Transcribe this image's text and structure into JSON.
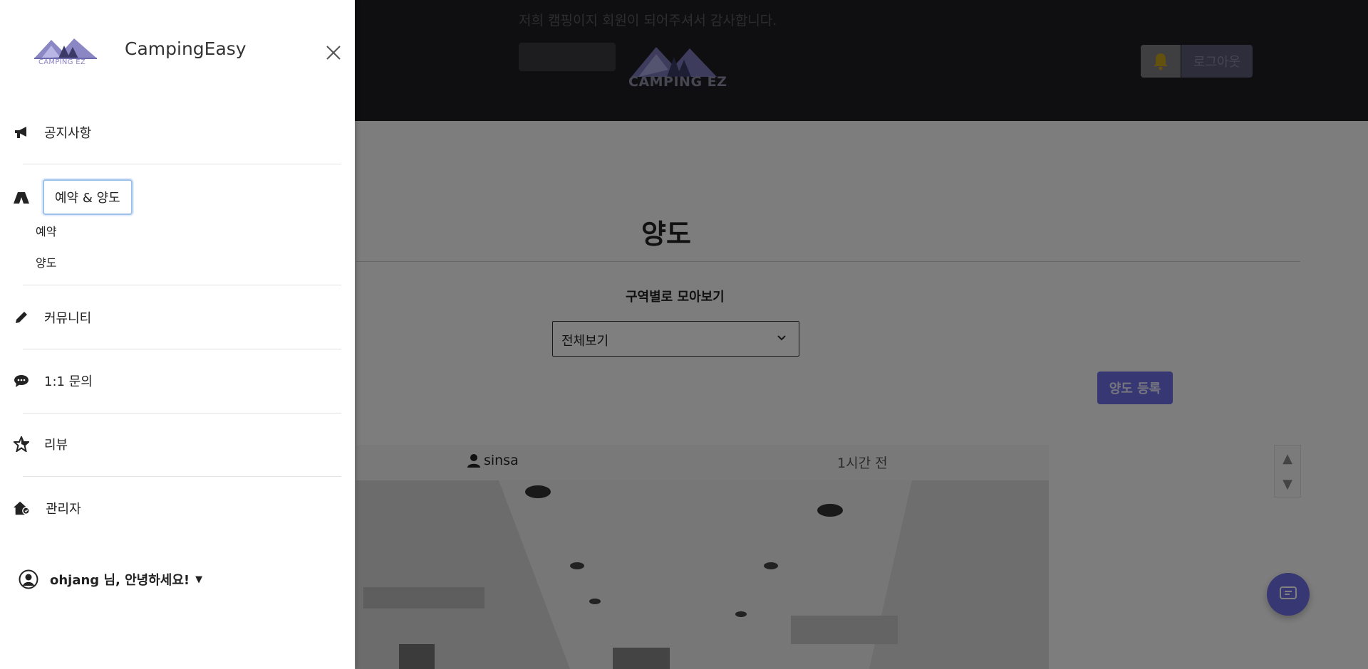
{
  "header": {
    "announcement": "저희 캠핑이지 회원이 되어주셔서 감사합니다.",
    "logo_text": "CAMPING EZ",
    "bell_icon": "bell-icon",
    "logout_label": "로그아웃",
    "bell_color": "#f5c518"
  },
  "main": {
    "title": "양도",
    "filter_label": "구역별로 모아보기",
    "filter_value": "전체보기",
    "register_label": "양도 등록",
    "post": {
      "username": "sinsa",
      "time": "1시간 전"
    },
    "accent_color": "#6e6ee6"
  },
  "drawer": {
    "logo_text": "CAMPING EZ",
    "brand": "CampingEasy",
    "menu": [
      {
        "label": "공지사항",
        "icon": "megaphone-icon"
      },
      {
        "label": "예약 & 양도",
        "icon": "tent-icon"
      },
      {
        "label": "커뮤니티",
        "icon": "pencil-icon"
      },
      {
        "label": "1:1 문의",
        "icon": "chat-bubble-icon"
      },
      {
        "label": "리뷰",
        "icon": "star-icon"
      },
      {
        "label": "관리자",
        "icon": "admin-house-icon"
      }
    ],
    "sub_items": [
      "예약",
      "양도"
    ],
    "user_greeting": "ohjang 님, 안녕하세요!"
  }
}
